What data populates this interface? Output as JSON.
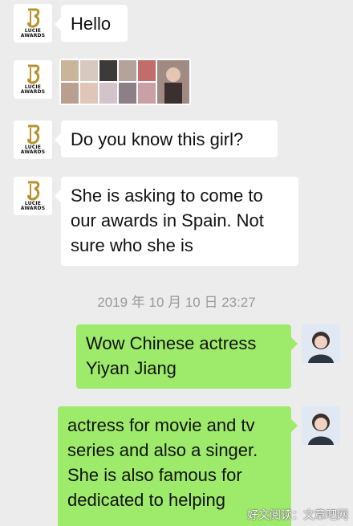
{
  "messages": {
    "m1": "Hello",
    "m3": "Do you know this girl?",
    "m4_line1": "She is asking to come to",
    "m4_line2": "our awards in Spain. Not",
    "m4_line3": "sure who she is",
    "timestamp": "2019 年 10 月 10 日  23:27",
    "m5_line1": "Wow Chinese actress",
    "m5_line2": "Yiyan Jiang",
    "m6_line1": "actress for movie and tv",
    "m6_line2": "series and also a singer.",
    "m6_line3": "She is also famous for",
    "m6_line4": "dedicated to helping"
  },
  "sender": {
    "logo_line1": "LUCIE",
    "logo_line2": "AWARDS"
  },
  "watermark": "好文阅读：文章吧网",
  "colors": {
    "background": "#ececec",
    "incoming_bubble": "#ffffff",
    "outgoing_bubble": "#9eea6a"
  }
}
